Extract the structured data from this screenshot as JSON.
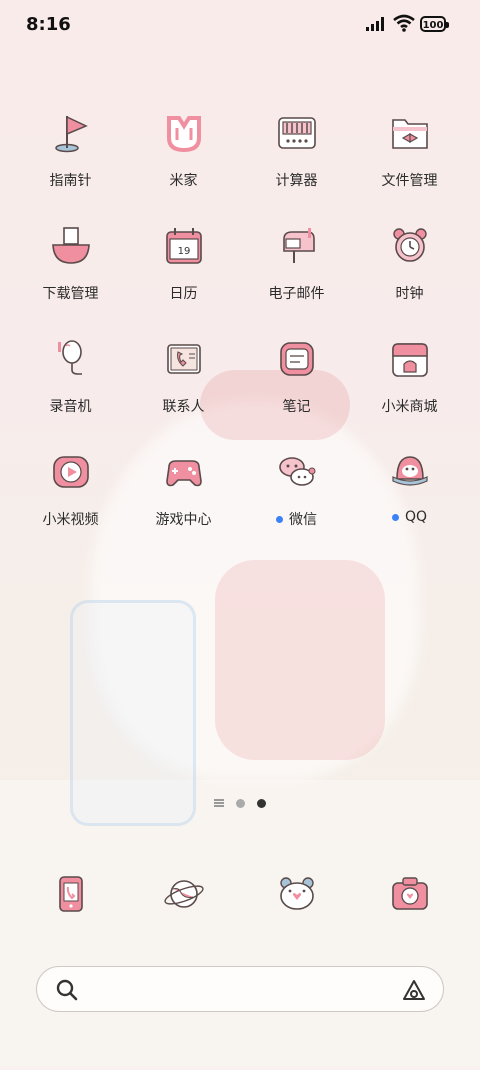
{
  "status_bar": {
    "time": "8:16",
    "battery": "100"
  },
  "apps": [
    {
      "label": "指南针",
      "icon": "compass-flag-icon",
      "dot": false
    },
    {
      "label": "米家",
      "icon": "mijia-icon",
      "dot": false
    },
    {
      "label": "计算器",
      "icon": "calculator-icon",
      "dot": false
    },
    {
      "label": "文件管理",
      "icon": "file-folder-icon",
      "dot": false
    },
    {
      "label": "下载管理",
      "icon": "download-icon",
      "dot": false
    },
    {
      "label": "日历",
      "icon": "calendar-icon",
      "calendar_day": "19",
      "dot": false
    },
    {
      "label": "电子邮件",
      "icon": "mailbox-icon",
      "dot": false
    },
    {
      "label": "时钟",
      "icon": "alarm-clock-icon",
      "dot": false
    },
    {
      "label": "录音机",
      "icon": "microphone-icon",
      "dot": false
    },
    {
      "label": "联系人",
      "icon": "contacts-book-icon",
      "dot": false
    },
    {
      "label": "笔记",
      "icon": "notes-icon",
      "dot": false
    },
    {
      "label": "小米商城",
      "icon": "mi-store-icon",
      "dot": false
    },
    {
      "label": "小米视频",
      "icon": "video-play-icon",
      "dot": false
    },
    {
      "label": "游戏中心",
      "icon": "gamepad-icon",
      "dot": false
    },
    {
      "label": "微信",
      "icon": "wechat-icon",
      "dot": true
    },
    {
      "label": "QQ",
      "icon": "qq-penguin-icon",
      "dot": true
    }
  ],
  "pager": {
    "pages": 2,
    "active": 2
  },
  "dock": [
    {
      "icon": "phone-icon"
    },
    {
      "icon": "browser-planet-icon"
    },
    {
      "icon": "messages-bear-icon"
    },
    {
      "icon": "camera-icon"
    }
  ],
  "search": {
    "placeholder": ""
  },
  "colors": {
    "accent_pink": "#ef8fa0",
    "notify_dot": "#3b82f6",
    "outline": "#5a4a4a"
  }
}
